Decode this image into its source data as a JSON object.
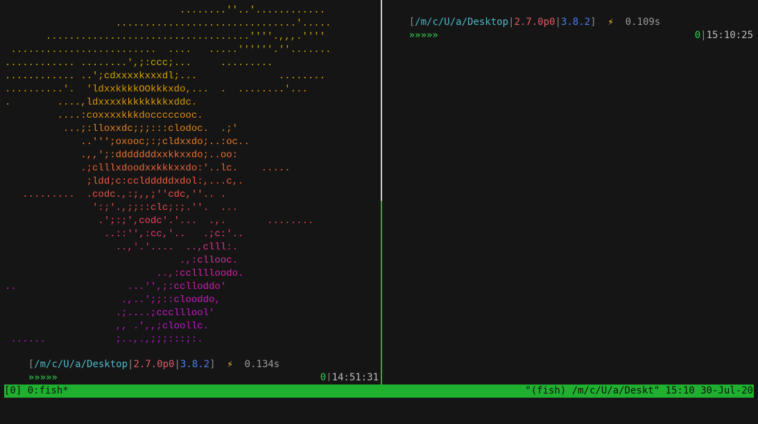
{
  "left_pane": {
    "art_lines": [
      {
        "text": "                              ........''..'............",
        "color": "#d4b000"
      },
      {
        "text": "                   ...............................'.....",
        "color": "#cfa900"
      },
      {
        "text": "       ...................................''''.,,,.''''",
        "color": "#c4a800"
      },
      {
        "text": " .........................  ....   .....''''''.''.......",
        "color": "#bfa800"
      },
      {
        "text": "............ ........',;:ccc;...     .........",
        "color": "#c6ad00"
      },
      {
        "text": "............ ..';cdxxxxkxxxdl;...              ........",
        "color": "#d5a500"
      },
      {
        "text": "..........'.  'ldxxkkkkOOkkkxdo,...  .  ........'...",
        "color": "#d89a00"
      },
      {
        "text": ".        ....,ldxxxxkkkkkkkkxddc.",
        "color": "#d99a10"
      },
      {
        "text": "         ....:coxxxxkkkdocccccooc.",
        "color": "#dd8f18"
      },
      {
        "text": "          ...;:lloxxdc;;;:::clodoc.  .;'",
        "color": "#e3861e"
      },
      {
        "text": "             ..''';oxooc;:;cldxxdo;..:oc..",
        "color": "#e67a28"
      },
      {
        "text": "             .,,';:dddddddxxkkxxdo;..oo:",
        "color": "#e87032"
      },
      {
        "text": "             .;clllxdoodxxkkkxxdo:'..lc.    .....",
        "color": "#ea6538"
      },
      {
        "text": "              ;ldd;c:ccldddddxdol:,...c,.",
        "color": "#ec5b40"
      },
      {
        "text": "   .........  .codc.,:;,,;''cdc,''.. .",
        "color": "#ee5248"
      },
      {
        "text": "               ':;'.,;;::clc;:;.''.  ...",
        "color": "#ed4a55"
      },
      {
        "text": "                .';:;',codc'.'...  .,.       ........",
        "color": "#ea4262"
      },
      {
        "text": "                 ..::'',:cc,'..   .;c:'..",
        "color": "#e63a72"
      },
      {
        "text": "                   ..,'.'....  ..,clll:.",
        "color": "#e03284"
      },
      {
        "text": "                              .,:cllooc.",
        "color": "#da2b96"
      },
      {
        "text": "                          ..,:cclllloodo.",
        "color": "#d424a6"
      },
      {
        "text": "..                   ...'',;:cclloddo'",
        "color": "#cd1fb4"
      },
      {
        "text": "                    .,..';;::clooddo,",
        "color": "#c71cc0"
      },
      {
        "text": "                   .;....;ccclllool'",
        "color": "#c21ac8"
      },
      {
        "text": "                   ,, .',,;cloollc.",
        "color": "#be19ce"
      },
      {
        "text": " ......            ;..,.,;;;:::;:.",
        "color": "#b917d4"
      }
    ],
    "prompt": {
      "bracket_open": "[",
      "path": "/m/c/U/a/Desktop",
      "sep1": "|",
      "ruby_version": "2.7.0p0",
      "sep2": "|",
      "python_version": "3.8.2",
      "bracket_close": "]",
      "bolt": "⚡",
      "duration": "0.134s",
      "chevrons": "»»»»»",
      "exit_code": "0",
      "sep3": "|",
      "clock": "14:51:31"
    }
  },
  "right_pane": {
    "prompt": {
      "bracket_open": "[",
      "path": "/m/c/U/a/Desktop",
      "sep1": "|",
      "ruby_version": "2.7.0p0",
      "sep2": "|",
      "python_version": "3.8.2",
      "bracket_close": "]",
      "bolt": "⚡",
      "duration": "0.109s",
      "chevrons": "»»»»»",
      "exit_code": "0",
      "sep3": "|",
      "clock": "15:10:25"
    }
  },
  "tmux_status": {
    "left": "[0] 0:fish*",
    "right": "\"(fish) /m/c/U/a/Deskt\" 15:10 30-Jul-20",
    "bg_color": "#1fb02f"
  }
}
